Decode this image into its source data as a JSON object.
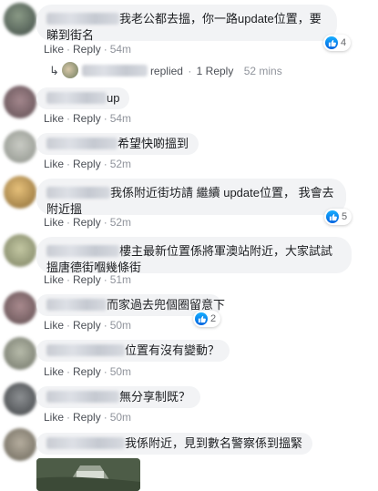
{
  "actions": {
    "like": "Like",
    "reply": "Reply",
    "dot": "·"
  },
  "colors": {
    "bubble": "#f2f3f5",
    "link": "#4b4f56",
    "muted": "#90949c",
    "like_blue": "#0062df"
  },
  "comments": [
    {
      "text": "我老公都去搵，你一路update位置，要睇到街名",
      "time": "54m",
      "reactions": "4",
      "reply_summary": {
        "replied": "replied",
        "count": "1 Reply",
        "time": "52 mins"
      }
    },
    {
      "text": "up",
      "time": "54m"
    },
    {
      "text": "希望快啲搵到",
      "time": "52m"
    },
    {
      "text": "我係附近街坊請 繼續 update位置， 我會去附近搵",
      "time": "52m",
      "reactions": "5"
    },
    {
      "text": "樓主最新位置係將軍澳站附近，大家試試搵唐德街嗰幾條街",
      "time": "51m"
    },
    {
      "text": "而家過去兜個圈留意下",
      "time": "50m",
      "reactions": "2"
    },
    {
      "text": "位置有沒有變動？",
      "time": "50m"
    },
    {
      "text": "無分享制既？",
      "time": "50m"
    },
    {
      "text": "我係附近，見到數名警察係到搵緊"
    }
  ]
}
